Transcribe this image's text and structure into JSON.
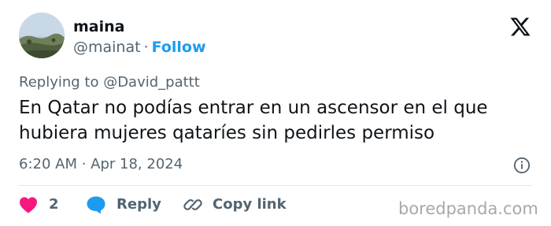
{
  "author": {
    "name": "maina",
    "handle": "@mainat",
    "separator": "·",
    "follow_label": "Follow"
  },
  "tweet": {
    "replying_to": "Replying to @David_pattt",
    "text_lines": [
      "En Qatar no podías entrar en un ascensor en el que",
      "hubiera mujeres qataríes sin pedirles permiso"
    ],
    "timestamp": "6:20 AM · Apr 18, 2024"
  },
  "actions": {
    "like_count": "2",
    "reply_label": "Reply",
    "copy_link_label": "Copy link"
  },
  "icons": {
    "logo": "x-logo-icon",
    "info": "info-icon",
    "like": "heart-icon",
    "reply": "speech-bubble-icon",
    "copy": "link-icon"
  },
  "colors": {
    "text": "#0f1419",
    "secondary": "#536471",
    "accent": "#1d9bf0",
    "heart": "#f91880",
    "divider": "#e1e8ed",
    "watermark": "#a8a8a8"
  },
  "watermark": "boredpanda.com"
}
